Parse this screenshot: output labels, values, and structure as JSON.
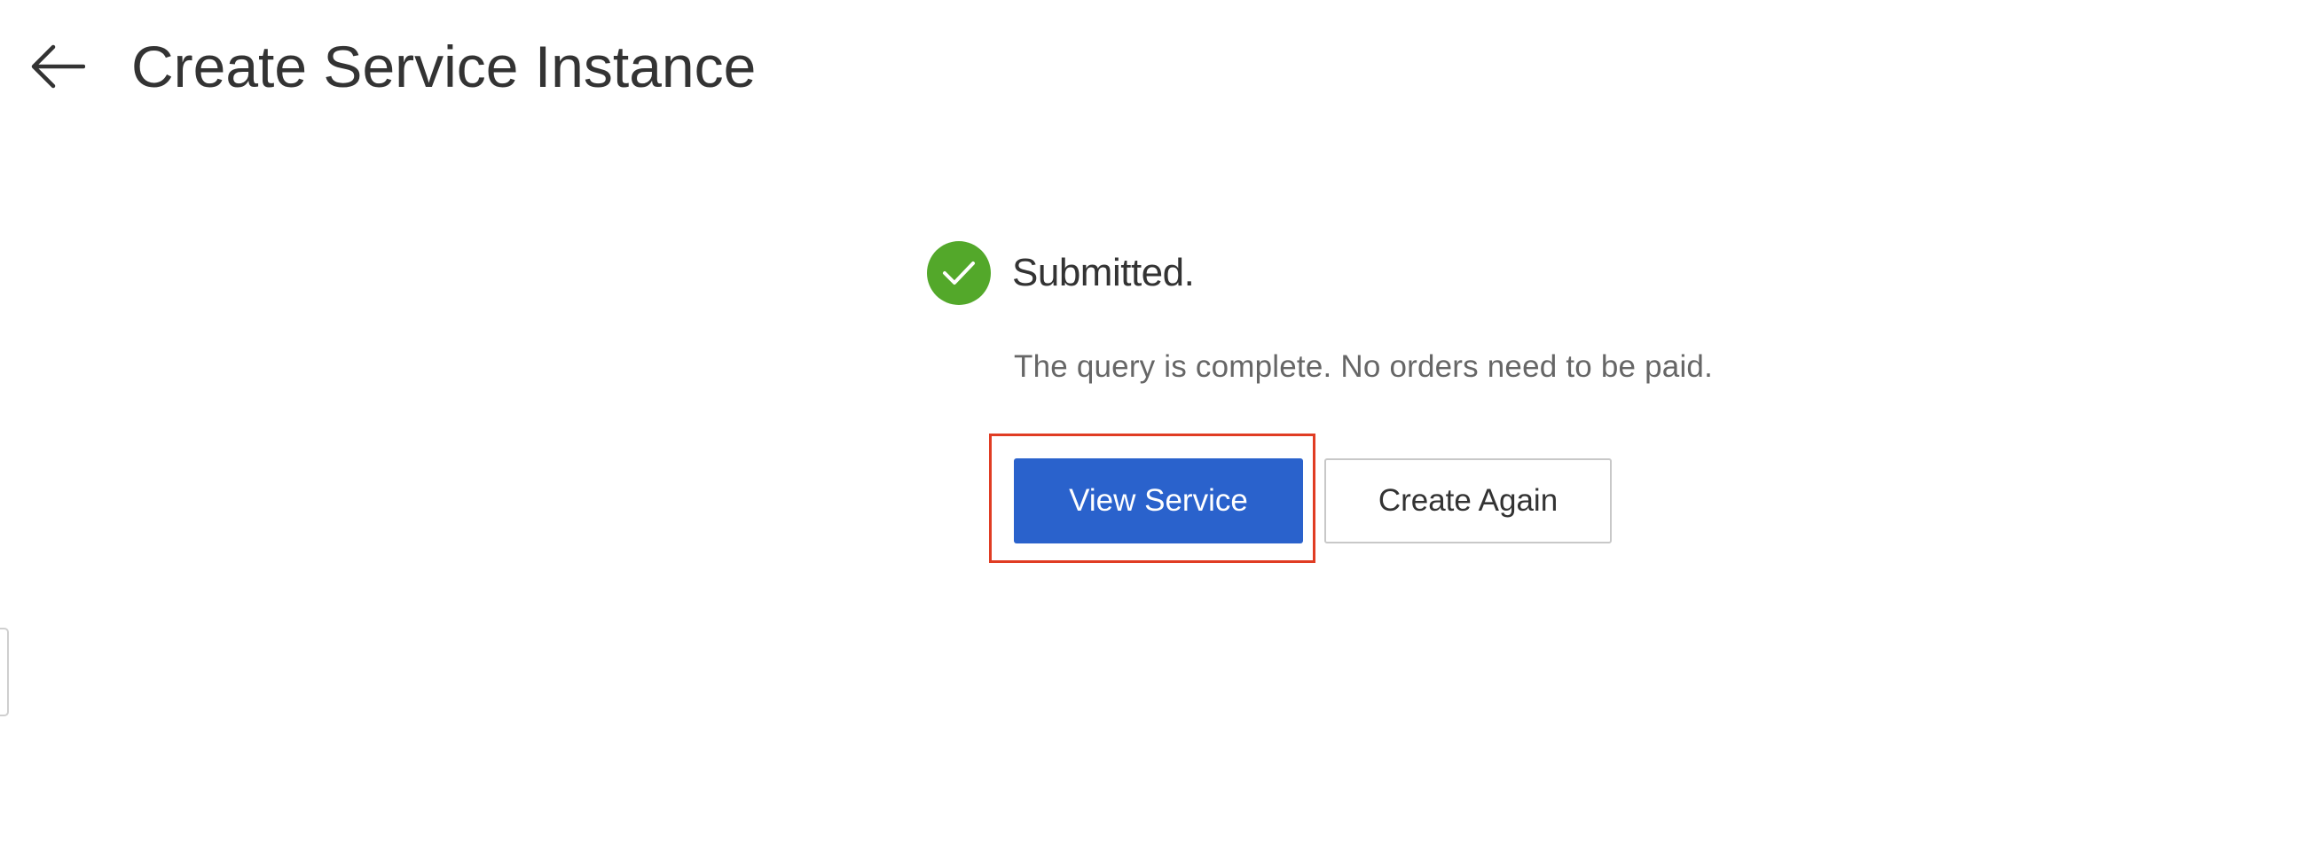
{
  "header": {
    "title": "Create Service Instance",
    "back_icon": "arrow-left-icon"
  },
  "result": {
    "status_icon": "check-circle-icon",
    "status_color": "#53a82a",
    "status_text": "Submitted.",
    "message": "The query is complete. No orders need to be paid.",
    "actions": {
      "view_service_label": "View Service",
      "create_again_label": "Create Again"
    }
  },
  "colors": {
    "primary": "#2a62cc",
    "highlight": "#e03c23",
    "text": "#333333",
    "muted_text": "#666666"
  }
}
